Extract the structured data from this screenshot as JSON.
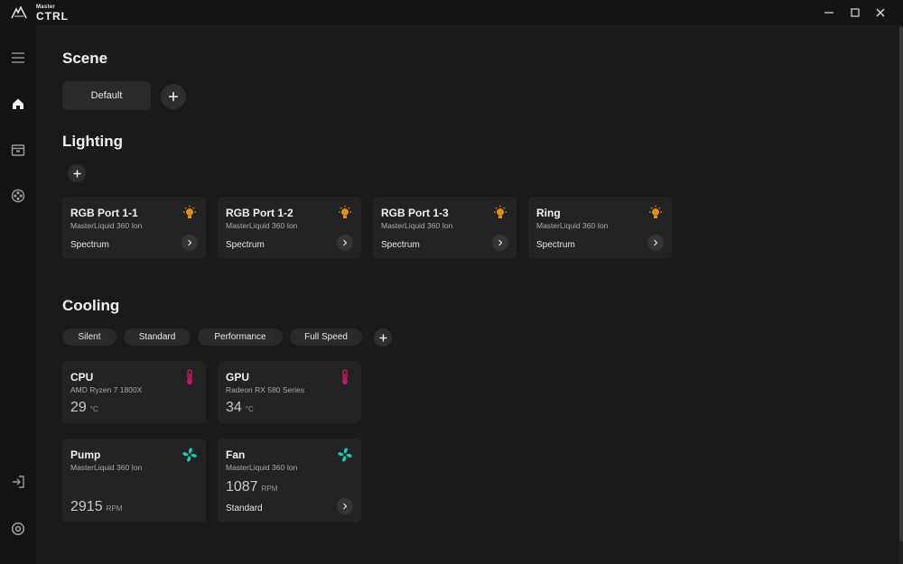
{
  "app": {
    "logo_small": "Master",
    "logo_big": "CTRL"
  },
  "scene": {
    "title": "Scene",
    "default_label": "Default",
    "add_icon": "plus-icon"
  },
  "lighting": {
    "title": "Lighting",
    "cards": [
      {
        "title": "RGB Port 1-1",
        "device": "MasterLiquid 360 Ion",
        "effect": "Spectrum"
      },
      {
        "title": "RGB Port 1-2",
        "device": "MasterLiquid 360 Ion",
        "effect": "Spectrum"
      },
      {
        "title": "RGB Port 1-3",
        "device": "MasterLiquid 360 Ion",
        "effect": "Spectrum"
      },
      {
        "title": "Ring",
        "device": "MasterLiquid 360 Ion",
        "effect": "Spectrum"
      }
    ]
  },
  "cooling": {
    "title": "Cooling",
    "modes": [
      "Silent",
      "Standard",
      "Performance",
      "Full Speed"
    ],
    "temps": [
      {
        "title": "CPU",
        "device": "AMD Ryzen 7 1800X",
        "value": "29",
        "unit": "°C"
      },
      {
        "title": "GPU",
        "device": "Radeon RX 580 Series",
        "value": "34",
        "unit": "°C"
      }
    ],
    "fans": [
      {
        "title": "Pump",
        "device": "MasterLiquid 360 Ion",
        "value": "2915",
        "unit": "RPM"
      },
      {
        "title": "Fan",
        "device": "MasterLiquid 360 Ion",
        "value": "1087",
        "unit": "RPM",
        "mode": "Standard"
      }
    ]
  },
  "colors": {
    "accent_bulb": "#d9901c",
    "accent_thermo": "#c2186b",
    "accent_fan": "#1ec8b8",
    "background": "#1a1a1a",
    "card": "#232323"
  }
}
